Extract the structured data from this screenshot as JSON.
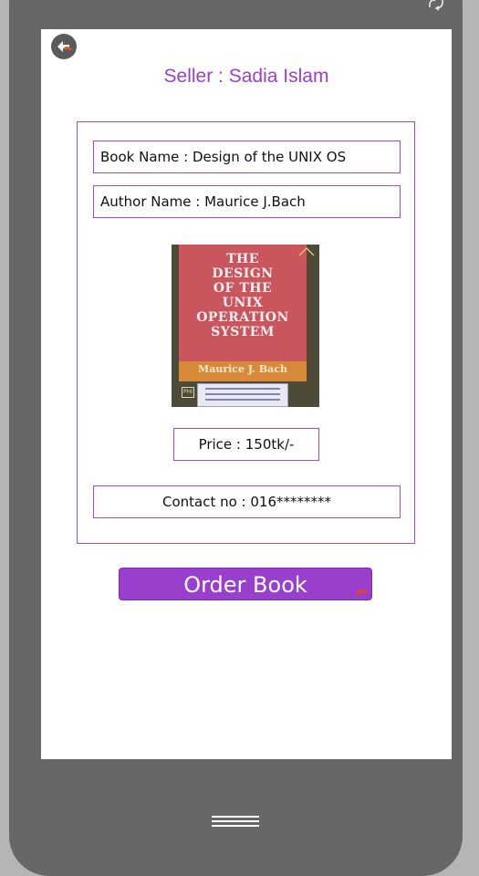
{
  "screen": {
    "seller_title": "Seller : Sadia Islam",
    "book_name": "Book Name : Design of the UNIX OS",
    "author_name": "Author Name : Maurice J.Bach",
    "price": "Price : 150tk/-",
    "contact": "Contact no : 016********",
    "order_button_label": "Order Book"
  },
  "book_cover": {
    "title_lines": [
      "THE",
      "DESIGN",
      "OF THE",
      "UNIX",
      "OPERATION",
      "SYSTEM"
    ],
    "author": "Maurice J. Bach",
    "publisher_mark": "PHI"
  },
  "icons": {
    "back": "back-arrow-icon",
    "rotate": "rotate-icon",
    "home": "home-bar-icon",
    "cursor": "pointer-cursor-icon"
  },
  "colors": {
    "accent": "#9a3fcd",
    "border": "#9a4fd1",
    "frame": "#676767",
    "background": "#b5b5b5"
  }
}
